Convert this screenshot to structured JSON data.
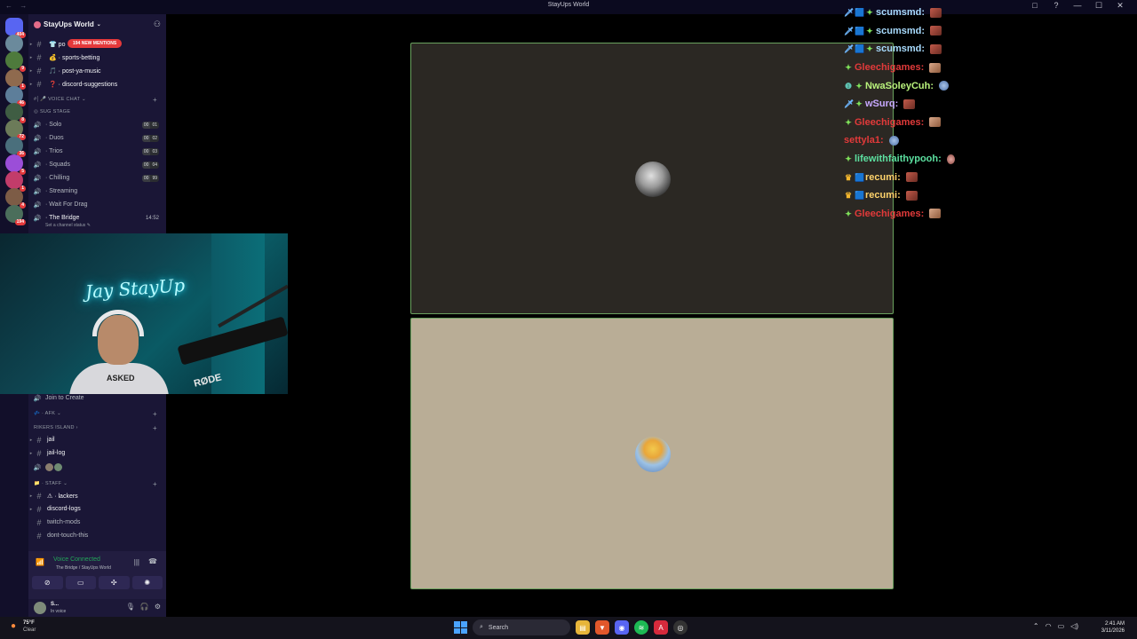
{
  "window": {
    "title": "StayUps World",
    "nav": "← →",
    "controls": [
      "□",
      "?",
      "—",
      "☐",
      "✕"
    ]
  },
  "rail": {
    "servers": [
      {
        "color": "#5865f2",
        "badge": "404"
      },
      {
        "color": "#6b8a9c",
        "badge": ""
      },
      {
        "color": "#4e7a3c",
        "badge": "9"
      },
      {
        "color": "#8f6a4e",
        "badge": "1"
      },
      {
        "color": "#5d7e9a",
        "badge": "46"
      },
      {
        "color": "#3f5d43",
        "badge": "8"
      },
      {
        "color": "#6c7b59",
        "badge": "72"
      },
      {
        "color": "#4a6f7c",
        "badge": "36"
      },
      {
        "color": "#9b4ed8",
        "badge": "5"
      },
      {
        "color": "#c23c6a",
        "badge": "1"
      },
      {
        "color": "#7d5c46",
        "badge": "4"
      },
      {
        "color": "#4b6e5b",
        "badge": "194"
      }
    ]
  },
  "sidebar": {
    "guild_name": "StayUps World",
    "mention_pill": "194 NEW MENTIONS",
    "text_channels": [
      {
        "label": "po",
        "emoji": "👕"
      },
      {
        "label": "sports-betting",
        "emoji": "💰"
      },
      {
        "label": "post-ya-music",
        "emoji": "🎵"
      },
      {
        "label": "discord-suggestions",
        "emoji": "❓"
      }
    ],
    "voice_category": "VOICE CHAT",
    "sug_stage": "SUG STAGE",
    "voice_channels": [
      {
        "label": "Solo",
        "count": "00",
        "limit": "01"
      },
      {
        "label": "Duos",
        "count": "00",
        "limit": "02"
      },
      {
        "label": "Trios",
        "count": "00",
        "limit": "03"
      },
      {
        "label": "Squads",
        "count": "00",
        "limit": "04"
      },
      {
        "label": "Chilling",
        "count": "00",
        "limit": "99"
      },
      {
        "label": "Streaming",
        "count": "",
        "limit": ""
      },
      {
        "label": "Wait For Drag",
        "count": "",
        "limit": ""
      }
    ],
    "active_channel": {
      "label": "The Bridge",
      "time": "14:52"
    },
    "status_hint": "Set a channel status",
    "join_to_create": "Join to Create",
    "afk_category": "AFK",
    "rikers_category": "Rikers Island",
    "lower_channels": [
      {
        "label": "jail",
        "bold": true
      },
      {
        "label": "jail-log",
        "bold": true
      }
    ],
    "staff_category": "Staff",
    "staff_channels": [
      {
        "label": "lackers",
        "bold": true
      },
      {
        "label": "discord-logs",
        "bold": true
      },
      {
        "label": "twitch-mods",
        "bold": false
      },
      {
        "label": "dont-touch-this",
        "bold": false
      }
    ]
  },
  "voice_panel": {
    "title": "Voice Connected",
    "subtitle": "The Bridge / StayUps World",
    "buttons": [
      "camera",
      "screen-share",
      "activities",
      "soundboard"
    ]
  },
  "user_panel": {
    "name": "S...",
    "status": "In voice"
  },
  "webcam": {
    "neon": "Jay StayUp",
    "shirt": "ASKED",
    "mic": "RØDE"
  },
  "chat": {
    "messages": [
      {
        "name": "scumsmd:",
        "color": "#a9dcff",
        "badges": [
          "🗡",
          "🟦",
          "✦"
        ],
        "emote": "red"
      },
      {
        "name": "scumsmd:",
        "color": "#a9dcff",
        "badges": [
          "🗡",
          "🟦",
          "✦"
        ],
        "emote": "red"
      },
      {
        "name": "scumsmd:",
        "color": "#a9dcff",
        "badges": [
          "🗡",
          "🟦",
          "✦"
        ],
        "emote": "red"
      },
      {
        "name": "Gleechigames:",
        "color": "#e23a3a",
        "badges": [
          "✦"
        ],
        "emote": "tan"
      },
      {
        "name": "NwaSoleyCuh:",
        "color": "#b9f27c",
        "badges": [
          "❶",
          "✦"
        ],
        "emote": "blue"
      },
      {
        "name": "wSurq:",
        "color": "#c7a8ff",
        "badges": [
          "🗡",
          "✦"
        ],
        "emote": "red"
      },
      {
        "name": "Gleechigames:",
        "color": "#e23a3a",
        "badges": [
          "✦"
        ],
        "emote": "tan"
      },
      {
        "name": "settyla1:",
        "color": "#e23a3a",
        "badges": [],
        "emote": "blue"
      },
      {
        "name": "lifewithfaithypooh:",
        "color": "#5ce0a0",
        "badges": [
          "✦"
        ],
        "emote": "pink"
      },
      {
        "name": "recumi:",
        "color": "#ffd36b",
        "badges": [
          "♛",
          "🟦"
        ],
        "emote": "red"
      },
      {
        "name": "recumi:",
        "color": "#ffd36b",
        "badges": [
          "♛",
          "🟦"
        ],
        "emote": "red"
      },
      {
        "name": "Gleechigames:",
        "color": "#e23a3a",
        "badges": [
          "✦"
        ],
        "emote": "tan"
      }
    ]
  },
  "taskbar": {
    "weather_temp": "75°F",
    "weather_desc": "Clear",
    "search_placeholder": "Search",
    "apps": [
      "file-explorer",
      "brave",
      "discord",
      "spotify",
      "adobe",
      "obs"
    ],
    "time": "2:41 AM",
    "date": "3/11/2026"
  },
  "colors": {
    "sidebar_bg": "#1a1636",
    "tile_border": "#6aa25e",
    "mention_red": "#e5393b"
  }
}
